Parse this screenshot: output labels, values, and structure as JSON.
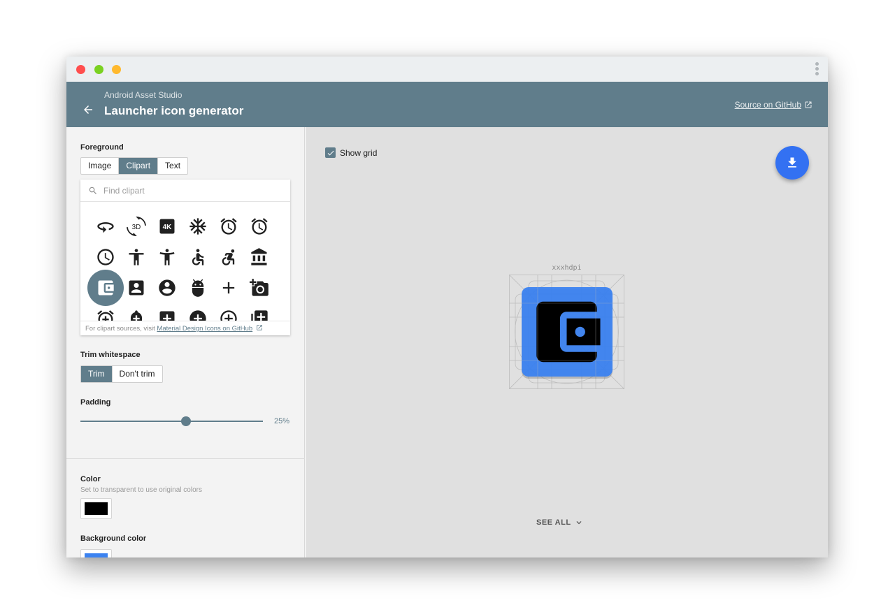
{
  "header": {
    "subtitle": "Android Asset Studio",
    "title": "Launcher icon generator",
    "source_link": "Source on GitHub"
  },
  "foreground": {
    "label": "Foreground",
    "tabs": [
      "Image",
      "Clipart",
      "Text"
    ],
    "active_tab": "Clipart",
    "search_placeholder": "Find clipart",
    "icons": [
      "rotate-360-icon",
      "3d-rotation-icon",
      "4k-icon",
      "ac-unit-icon",
      "access-alarm-icon",
      "access-alarms-icon",
      "access-time-icon",
      "accessibility-icon",
      "accessibility-new-icon",
      "accessible-icon",
      "accessible-forward-icon",
      "account-balance-icon",
      "account-balance-wallet-icon",
      "account-box-icon",
      "account-circle-icon",
      "adb-icon",
      "add-icon",
      "add-a-photo-icon",
      "add-alarm-icon",
      "add-alert-icon",
      "add-box-icon",
      "add-circle-icon",
      "add-circle-outline-icon",
      "add-to-photos-icon"
    ],
    "selected_icon": "account-balance-wallet-icon",
    "footer_text": "For clipart sources, visit ",
    "footer_link": "Material Design Icons on GitHub"
  },
  "trim": {
    "label": "Trim whitespace",
    "options": [
      "Trim",
      "Don't trim"
    ],
    "active": "Trim"
  },
  "padding": {
    "label": "Padding",
    "value": 25,
    "display": "25%"
  },
  "color": {
    "label": "Color",
    "help": "Set to transparent to use original colors",
    "value": "#000000"
  },
  "background_color": {
    "label": "Background color",
    "value": "#3b82f0"
  },
  "preview": {
    "show_grid_label": "Show grid",
    "show_grid": true,
    "density": "xxxhdpi",
    "see_all": "SEE ALL"
  },
  "colors": {
    "appbar": "#607d8b",
    "accent": "#3371f2",
    "icon_background": "#3b82f0",
    "icon_foreground": "#000000"
  }
}
